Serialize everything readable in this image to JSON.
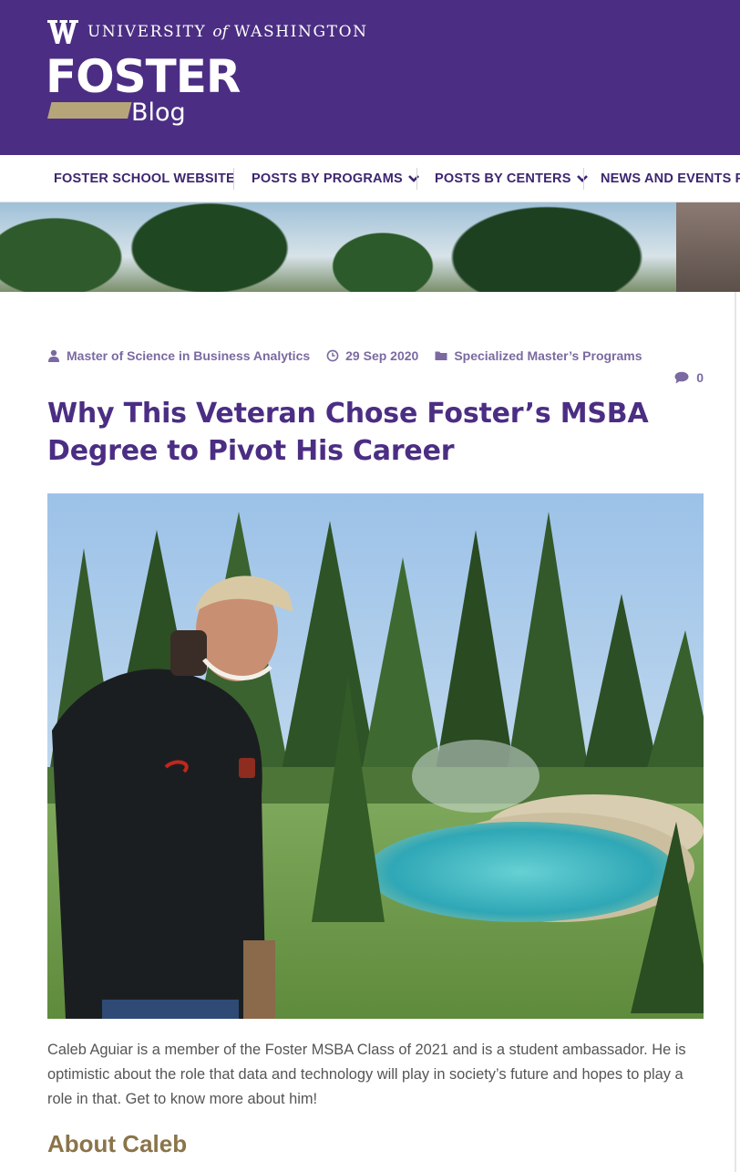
{
  "header": {
    "university_prefix": "UNIVERSITY",
    "university_of": "of",
    "university_suffix": "WASHINGTON",
    "logo_main": "FOSTER",
    "logo_sub": "Blog"
  },
  "nav": {
    "items": [
      {
        "label": "FOSTER SCHOOL WEBSITE",
        "has_dropdown": false
      },
      {
        "label": "POSTS BY PROGRAMS",
        "has_dropdown": true
      },
      {
        "label": "POSTS BY CENTERS",
        "has_dropdown": true
      },
      {
        "label": "NEWS AND EVENTS PO",
        "has_dropdown": false
      }
    ]
  },
  "post": {
    "author": "Master of Science in Business Analytics",
    "date": "29 Sep 2020",
    "category": "Specialized Master’s Programs",
    "comment_count": "0",
    "title": "Why This Veteran Chose Foster’s MSBA Degree to Pivot His Career",
    "intro": "Caleb Aguiar is a member of the Foster MSBA Class of 2021 and is a student ambassador. He is optimistic about the role that data and technology will play in society’s future and hopes to play a role in that. Get to know more about him!",
    "subheading": "About Caleb"
  },
  "colors": {
    "brand_purple": "#4b2e83",
    "brand_gold": "#b7a57a",
    "meta_purple": "#7b6aa1",
    "subheading_gold": "#8a7449"
  },
  "icons": [
    "uw-w-logo-icon",
    "chevron-down-icon",
    "user-icon",
    "clock-icon",
    "folder-icon",
    "comment-icon"
  ]
}
